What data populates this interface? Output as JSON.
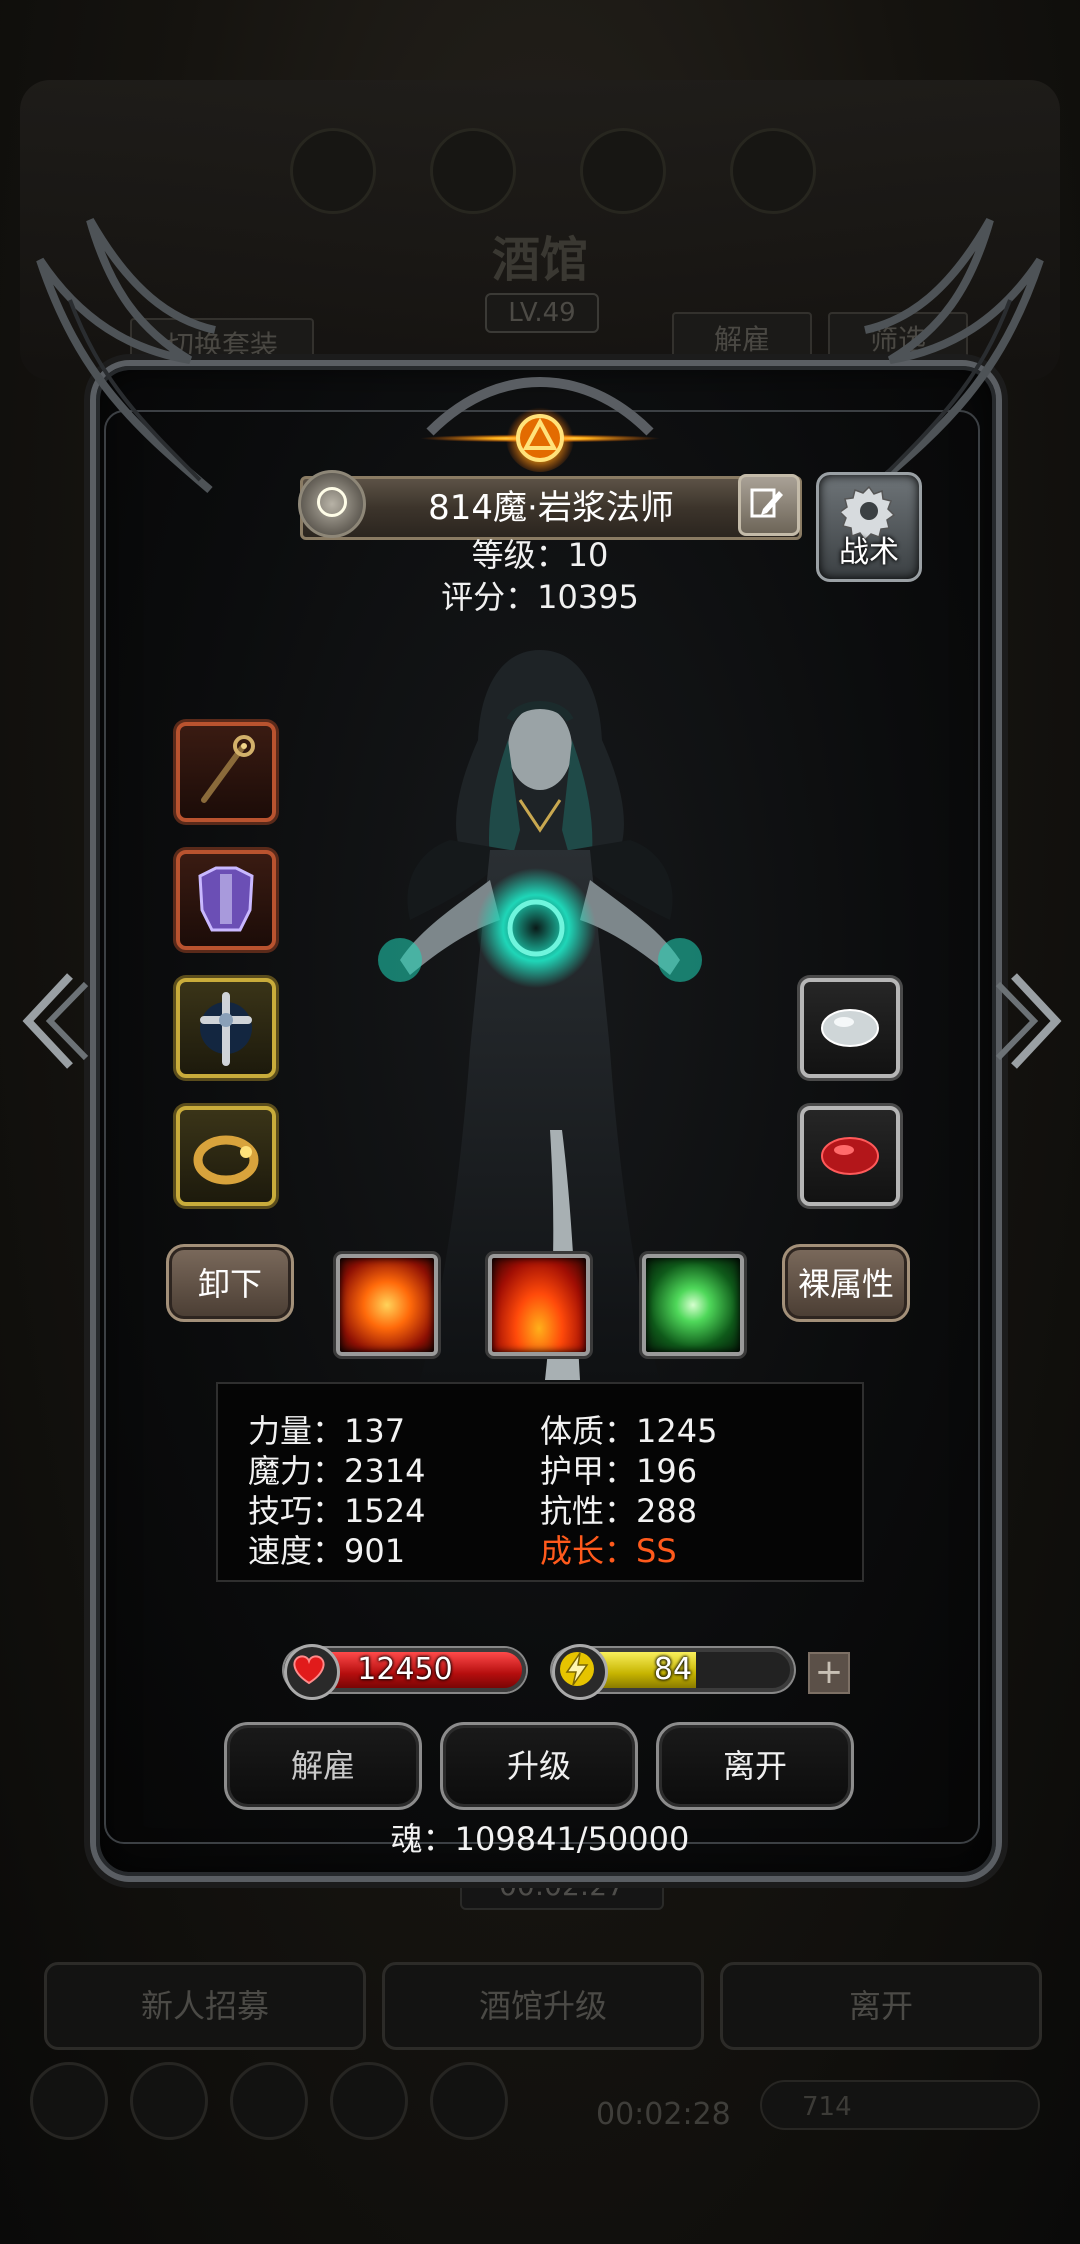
{
  "background": {
    "title": "酒馆",
    "level": "LV.49",
    "switch_outfit": "切换套装",
    "dismiss": "解雇",
    "filter": "筛选",
    "timer": "00:02:27",
    "recruit": "新人招募",
    "upgrade_tavern": "酒馆升级",
    "leave": "离开",
    "timer2": "00:02:28",
    "bar_value": "714"
  },
  "hero": {
    "name": "814魔·岩浆法师",
    "tactics_label": "战术",
    "level": "等级：10",
    "score": "评分：10395"
  },
  "equipment": {
    "left": [
      "staff-icon",
      "chest-armor-icon",
      "amulet-icon",
      "ring-icon"
    ],
    "right": [
      "white-gem-icon",
      "red-gem-icon"
    ]
  },
  "actions": {
    "unequip": "卸下",
    "base_attributes": "裸属性",
    "skills": [
      "fire-burst-skill-icon",
      "flame-skill-icon",
      "green-crystal-skill-icon"
    ]
  },
  "stats": {
    "strength": "力量：137",
    "magic": "魔力：2314",
    "skill": "技巧：1524",
    "speed": "速度：901",
    "constitution": "体质：1245",
    "armor": "护甲：196",
    "resistance": "抗性：288",
    "growth": "成长：SS"
  },
  "vitals": {
    "hp": "12450",
    "energy": "84",
    "energy_fraction": 0.6,
    "plus": "+"
  },
  "buttons": {
    "dismiss": "解雇",
    "upgrade": "升级",
    "leave": "离开"
  },
  "soul": "魂：109841/50000",
  "colors": {
    "growth": "#ff5a1c",
    "hp": "#d81a1a",
    "energy": "#d9c800"
  }
}
